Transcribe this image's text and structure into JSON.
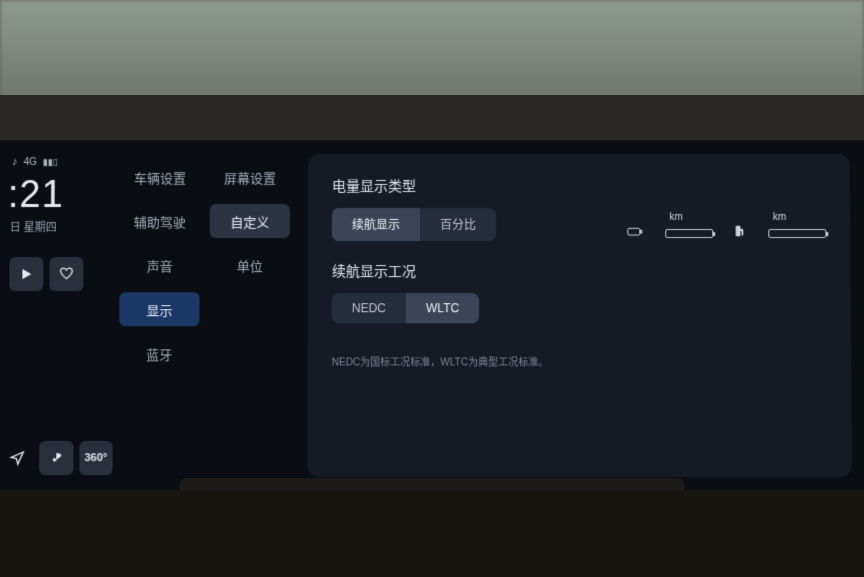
{
  "status": {
    "signal_label": "4G",
    "signal_icon": "signal-icon",
    "bell_icon": "bell-icon"
  },
  "clock": {
    "time": ":21",
    "date": "日 星期四"
  },
  "media": {
    "play_icon": "play-icon",
    "heart_icon": "heart-icon",
    "nav_icon": "nav-icon",
    "music_icon": "music-icon",
    "cam_label": "360°"
  },
  "menu1": {
    "items": [
      {
        "label": "车辆设置"
      },
      {
        "label": "辅助驾驶"
      },
      {
        "label": "声音"
      },
      {
        "label": "显示",
        "active": true
      },
      {
        "label": "蓝牙"
      }
    ]
  },
  "menu2": {
    "items": [
      {
        "label": "屏幕设置"
      },
      {
        "label": "自定义",
        "active": true
      },
      {
        "label": "单位"
      }
    ]
  },
  "panel": {
    "section1_title": "电量显示类型",
    "seg1": {
      "opt1": "续航显示",
      "opt2": "百分比",
      "selected": 0
    },
    "section2_title": "续航显示工况",
    "seg2": {
      "opt1": "NEDC",
      "opt2": "WLTC",
      "selected": 1
    },
    "desc": "NEDC为国标工况标准，WLTC为典型工况标准。",
    "range": {
      "unit1": "km",
      "unit2": "km"
    }
  },
  "hazard_icon": "hazard-icon"
}
